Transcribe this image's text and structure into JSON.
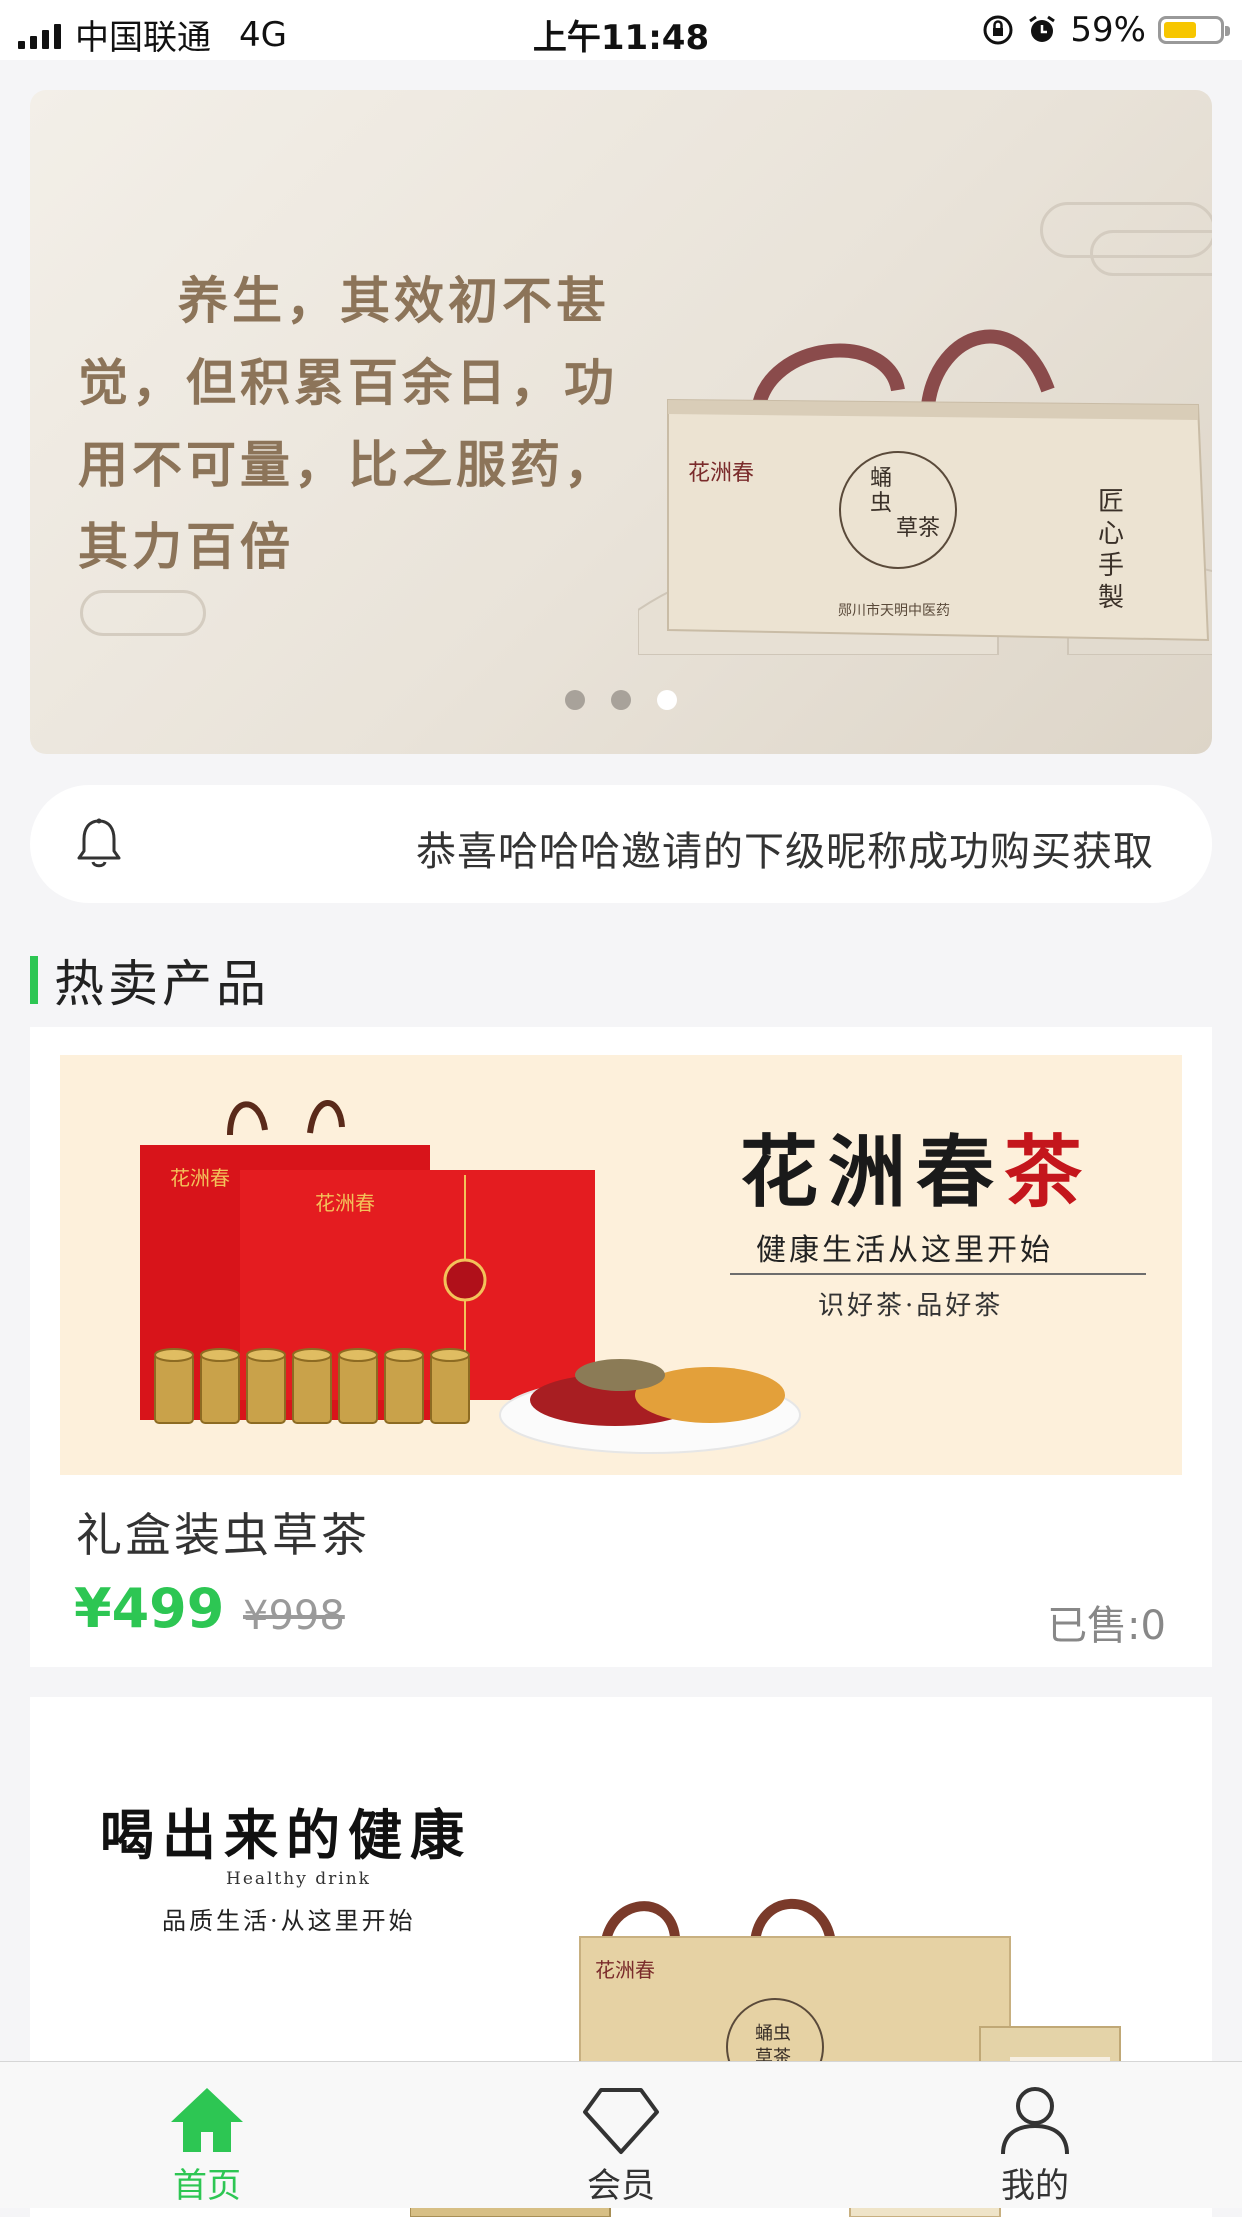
{
  "status_bar": {
    "carrier": "中国联通",
    "network": "4G",
    "time": "上午11:48",
    "battery": "59%",
    "battery_level": 0.59,
    "icons": [
      "signal-icon",
      "orientation-lock-icon",
      "alarm-icon",
      "battery-icon"
    ]
  },
  "banner": {
    "slogan": "养生，其效初不甚觉，但积累百余日，功用不可量，比之服药，其力百倍",
    "slide_count": 3,
    "active_slide": 3
  },
  "notice": {
    "icon": "bell-icon",
    "text": "恭喜哈哈哈邀请的下级昵称成功购买获取"
  },
  "section": {
    "title": "热卖产品",
    "accent_color": "#2dc653"
  },
  "products": [
    {
      "name": "礼盒装虫草茶",
      "price": "¥499",
      "original_price": "¥998",
      "sold": "已售:0",
      "image": {
        "headline_part1": "花洲春",
        "headline_part2": "茶",
        "line1": "健康生活从这里开始",
        "line2": "识好茶·品好茶"
      }
    },
    {
      "image": {
        "headline": "喝出来的健康",
        "english": "Healthy drink",
        "line1": "品质生活·从这里开始"
      }
    }
  ],
  "tabbar": {
    "items": [
      {
        "label": "首页",
        "icon": "home-icon",
        "active": true
      },
      {
        "label": "会员",
        "icon": "diamond-icon",
        "active": false
      },
      {
        "label": "我的",
        "icon": "person-icon",
        "active": false
      }
    ],
    "active_color": "#2dc653"
  }
}
